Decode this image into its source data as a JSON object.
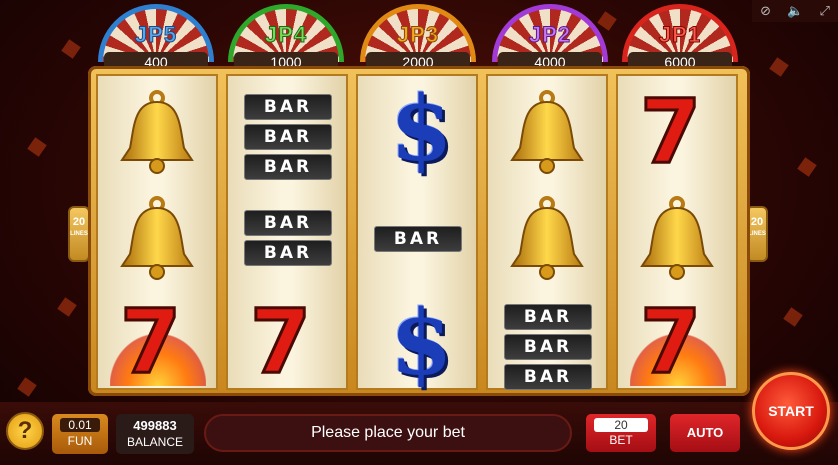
{
  "jackpots": [
    {
      "label": "JP5",
      "value": "400",
      "color": "#5aa8e8",
      "rim": "#2f7fd0"
    },
    {
      "label": "JP4",
      "value": "1000",
      "color": "#7ed957",
      "rim": "#2ea82a"
    },
    {
      "label": "JP3",
      "value": "2000",
      "color": "#f5a623",
      "rim": "#e08a14"
    },
    {
      "label": "JP2",
      "value": "4000",
      "color": "#c87af0",
      "rim": "#a23ad8"
    },
    {
      "label": "JP1",
      "value": "6000",
      "color": "#ff5a4a",
      "rim": "#d8241c"
    }
  ],
  "lines_badge": {
    "count": "20",
    "label": "LINES"
  },
  "symbols": {
    "bar": "BAR",
    "dollar": "$",
    "seven": "7"
  },
  "coin": {
    "value": "0.01",
    "label": "FUN"
  },
  "balance": {
    "value": "499883",
    "label": "BALANCE"
  },
  "message": "Please place your bet",
  "bet": {
    "value": "20",
    "label": "BET"
  },
  "auto_label": "AUTO",
  "start_label": "START",
  "help_label": "?",
  "top_icons": [
    "no-ads-icon",
    "sound-icon",
    "fullscreen-icon"
  ]
}
